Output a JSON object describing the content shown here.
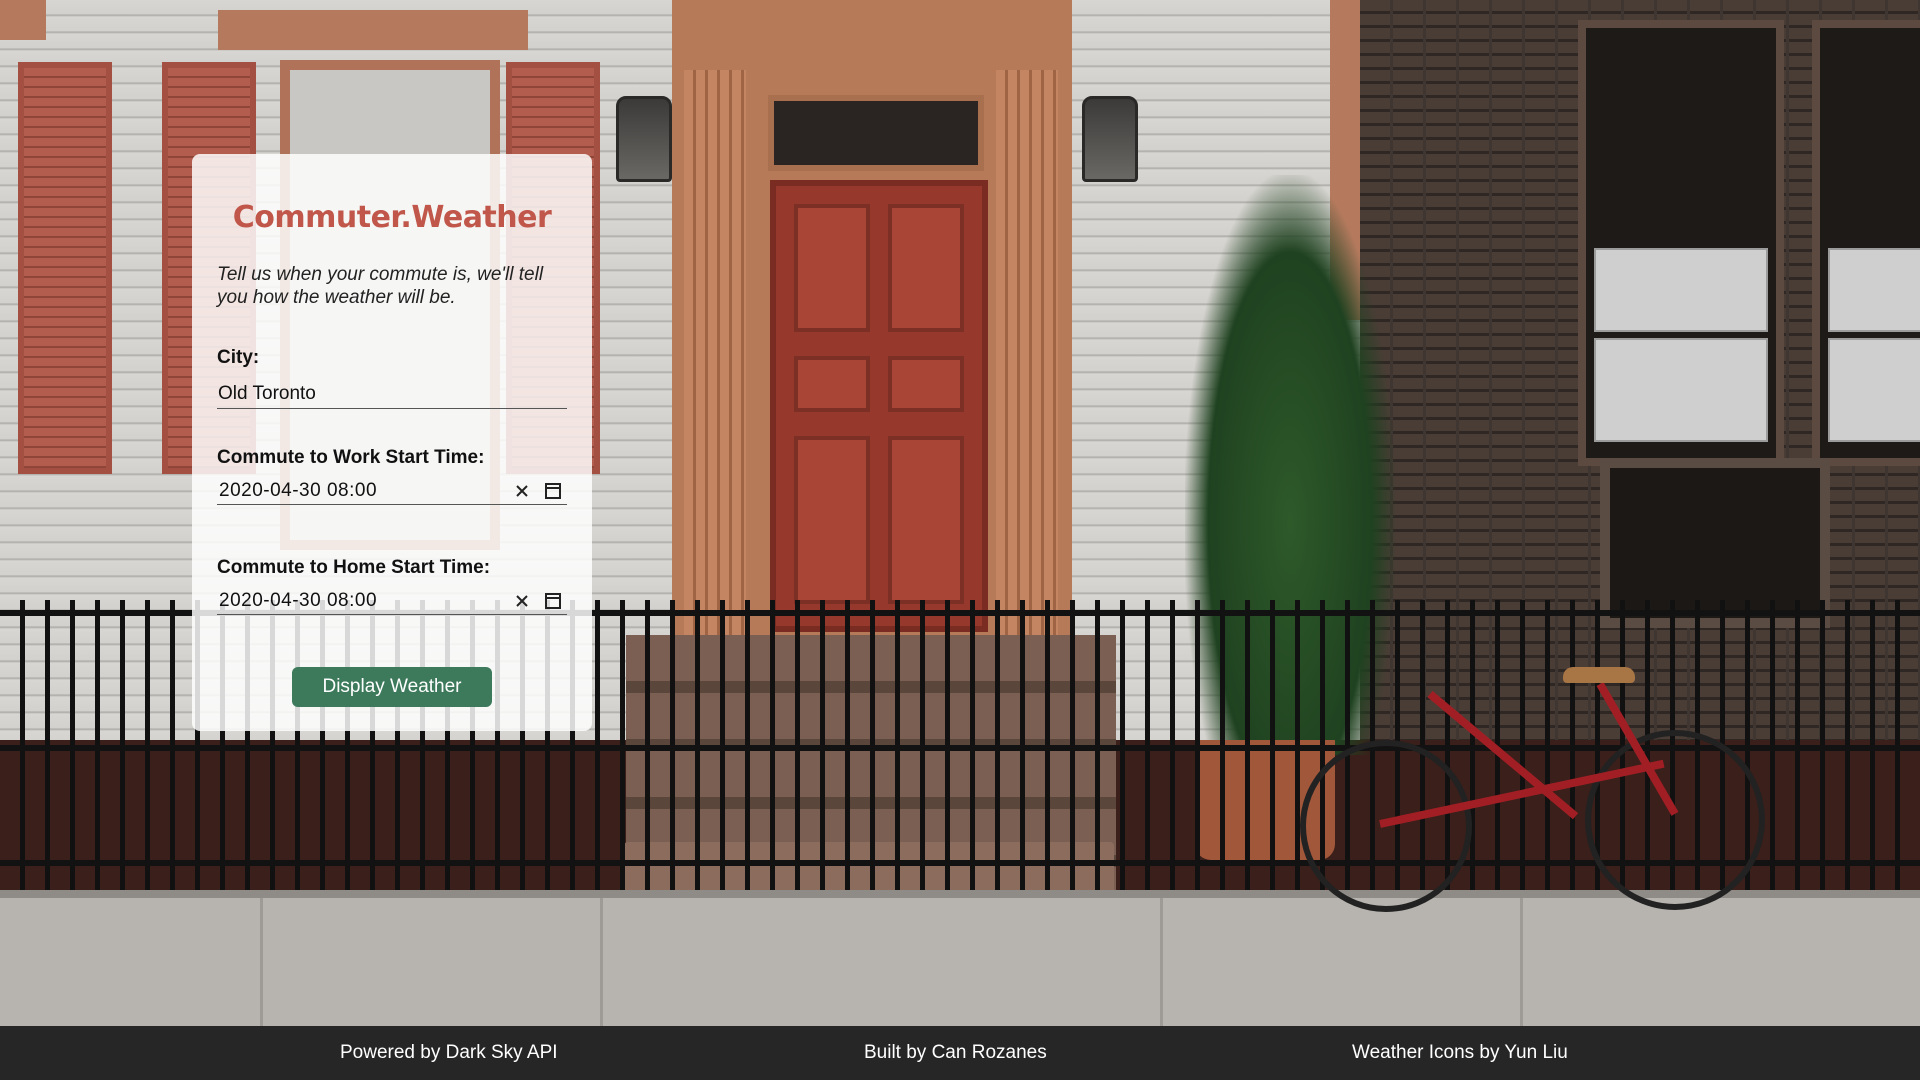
{
  "app": {
    "title": "Commuter.Weather",
    "tagline": "Tell us when your commute is, we'll tell you how the weather will be."
  },
  "form": {
    "city_label": "City:",
    "city_value": "Old Toronto",
    "work_label": "Commute to Work Start Time:",
    "work_value": "2020-04-30 08:00",
    "home_label": "Commute to Home Start Time:",
    "home_value": "2020-04-30 08:00",
    "clear_icon": "close-icon",
    "calendar_icon": "calendar-icon",
    "submit_label": "Display Weather"
  },
  "footer": {
    "powered_by": "Powered by Dark Sky API",
    "built_by": "Built by Can Rozanes",
    "icons_by": "Weather Icons by Yun Liu"
  },
  "colors": {
    "title": "#c0574a",
    "button": "#3c7a5b",
    "footer_bg": "#262626"
  }
}
